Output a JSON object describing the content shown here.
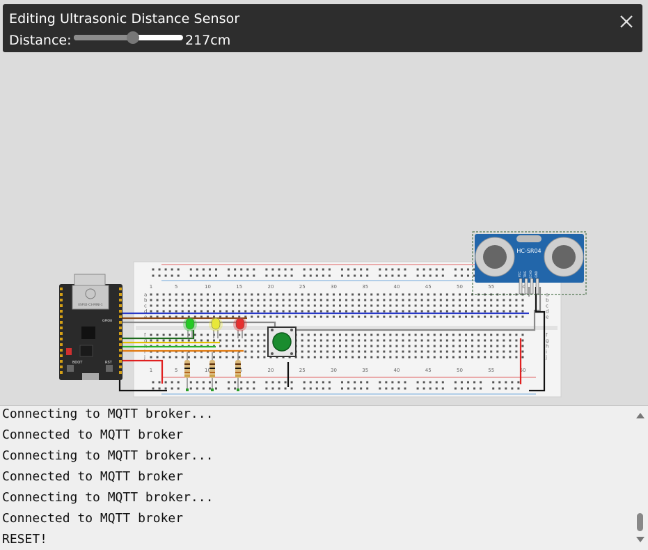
{
  "popup": {
    "title": "Editing Ultrasonic Distance Sensor",
    "distance_label": "Distance:",
    "distance_value": "217cm",
    "slider_fraction": 0.54
  },
  "canvas": {
    "esp32": {
      "module_text": "ESP32-C3-MINI-1",
      "button_boot": "BOOT",
      "button_rst": "RST",
      "label_gpio": "GPIO8"
    },
    "breadboard": {
      "column_numbers": [
        "1",
        "5",
        "10",
        "15",
        "20",
        "25",
        "30",
        "35",
        "40",
        "45",
        "50",
        "55",
        "60"
      ],
      "row_letters_top": [
        "a",
        "b",
        "c",
        "d",
        "e"
      ],
      "row_letters_bottom": [
        "f",
        "g",
        "h",
        "i",
        "j"
      ]
    },
    "sensor": {
      "label": "HC-SR04",
      "pins": [
        "VCC",
        "TRIG",
        "ECHO",
        "GND"
      ]
    },
    "leds": [
      {
        "color": "green",
        "hex": "#25c925"
      },
      {
        "color": "yellow",
        "hex": "#e8e83a"
      },
      {
        "color": "red",
        "hex": "#e63030"
      }
    ],
    "button_color": "#1a8c2e"
  },
  "monitor": {
    "lines": [
      "Connecting to MQTT broker...",
      "Connected to MQTT broker",
      "Connecting to MQTT broker...",
      "Connected to MQTT broker",
      "Connecting to MQTT broker...",
      "Connected to MQTT broker",
      "RESET!"
    ]
  }
}
